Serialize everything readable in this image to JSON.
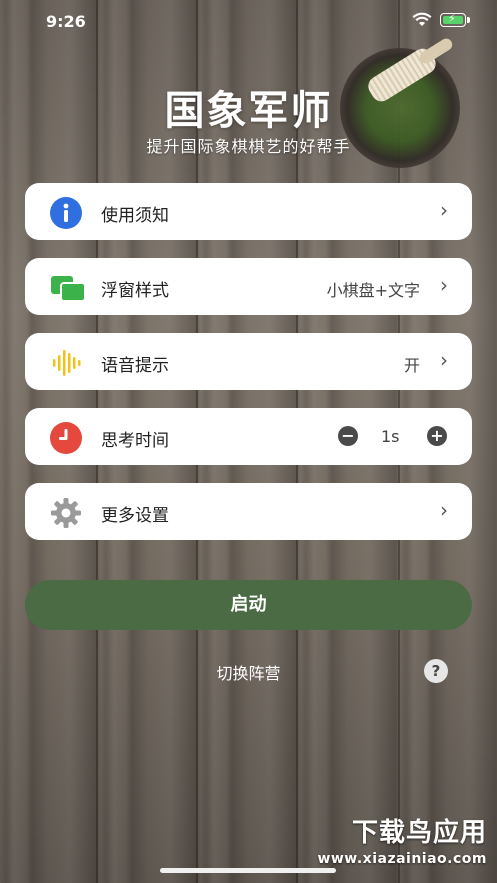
{
  "status_bar": {
    "time": "9:26"
  },
  "header": {
    "title": "国象军师",
    "subtitle": "提升国际象棋棋艺的好帮手"
  },
  "menu": {
    "notice": {
      "label": "使用须知",
      "icon": "info-icon"
    },
    "float_style": {
      "label": "浮窗样式",
      "value": "小棋盘+文字",
      "icon": "windows-icon"
    },
    "voice": {
      "label": "语音提示",
      "value": "开",
      "icon": "sound-wave-icon"
    },
    "think_time": {
      "label": "思考时间",
      "value": "1s",
      "icon": "clock-icon"
    },
    "more": {
      "label": "更多设置",
      "icon": "gear-icon"
    }
  },
  "actions": {
    "launch": "启动",
    "switch_side": "切换阵营",
    "help": "?"
  },
  "watermark": {
    "brand": "下载鸟应用",
    "url": "www.xiazainiao.com"
  },
  "colors": {
    "launch_button": "#4a6b44",
    "info_blue": "#2f6fe0",
    "float_green": "#3cb34a",
    "voice_yellow": "#f2c21b",
    "clock_red": "#e5483d"
  }
}
